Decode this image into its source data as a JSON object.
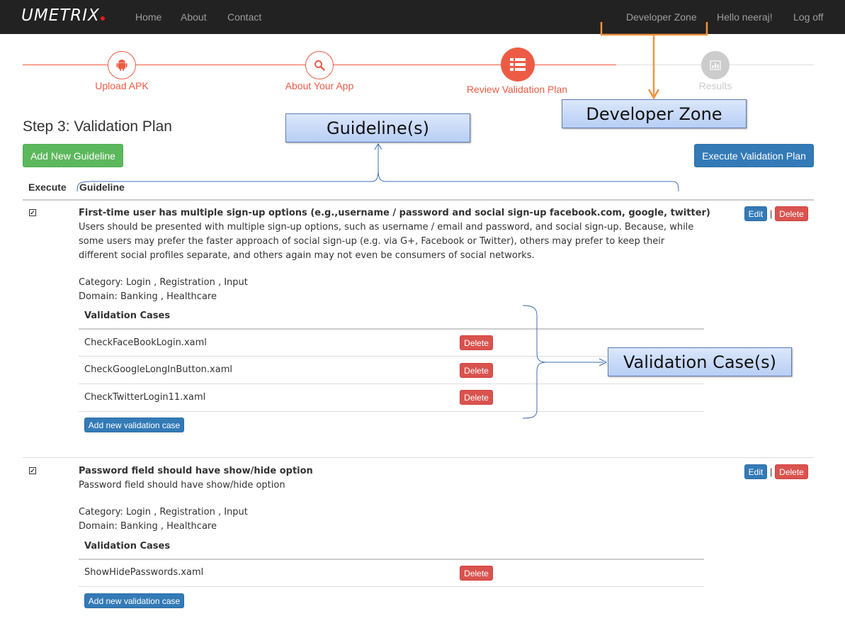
{
  "navbar": {
    "brand": "UMETRIX",
    "links": [
      "Home",
      "About",
      "Contact"
    ],
    "right_links": [
      "Developer Zone",
      "Hello neeraj!",
      "Log off"
    ]
  },
  "wizard": {
    "steps": [
      {
        "label": "Upload APK",
        "icon": "android-icon",
        "state": "done"
      },
      {
        "label": "About Your App",
        "icon": "search-icon",
        "state": "done"
      },
      {
        "label": "Review Validation Plan",
        "icon": "list-icon",
        "state": "active"
      },
      {
        "label": "Results",
        "icon": "bar-chart-icon",
        "state": "pending"
      }
    ],
    "colors": {
      "active": "#ee5b44",
      "pending": "#cccccc"
    }
  },
  "page": {
    "title": "Step 3: Validation Plan",
    "add_guideline_label": "Add New Guideline",
    "execute_plan_label": "Execute Validation Plan"
  },
  "table": {
    "headers": {
      "execute": "Execute",
      "guideline": "Guideline"
    },
    "edit_label": "Edit",
    "delete_label": "Delete",
    "separator": "|",
    "validation_cases_heading": "Validation Cases",
    "add_case_label": "Add new validation case"
  },
  "guidelines": [
    {
      "checked": true,
      "title": "First-time user has multiple sign-up options (e.g.,username / password and social sign-up facebook.com, google, twitter)",
      "description": "Users should be presented with multiple sign-up options, such as username / email and password, and social sign-up. Because, while some users may prefer the faster approach of social sign-up (e.g. via G+, Facebook or Twitter), others may prefer to keep their different social profiles separate, and others again may not even be consumers of social networks.",
      "category": "Category: Login , Registration , Input",
      "domain": "Domain: Banking , Healthcare",
      "validation_cases": [
        "CheckFaceBookLogin.xaml",
        "CheckGoogleLongInButton.xaml",
        "CheckTwitterLogin11.xaml"
      ]
    },
    {
      "checked": true,
      "title": "Password field should have show/hide option",
      "description": "Password field should have show/hide option",
      "category": "Category: Login , Registration , Input",
      "domain": "Domain: Banking , Healthcare",
      "validation_cases": [
        "ShowHidePasswords.xaml"
      ]
    }
  ],
  "annotations": {
    "guidelines": "Guideline(s)",
    "developer_zone": "Developer Zone",
    "validation_cases": "Validation Case(s)",
    "colors": {
      "callout_border": "#5f7fb5",
      "orange_arrow": "#f0943f",
      "blue_line": "#3a6fb5"
    }
  }
}
